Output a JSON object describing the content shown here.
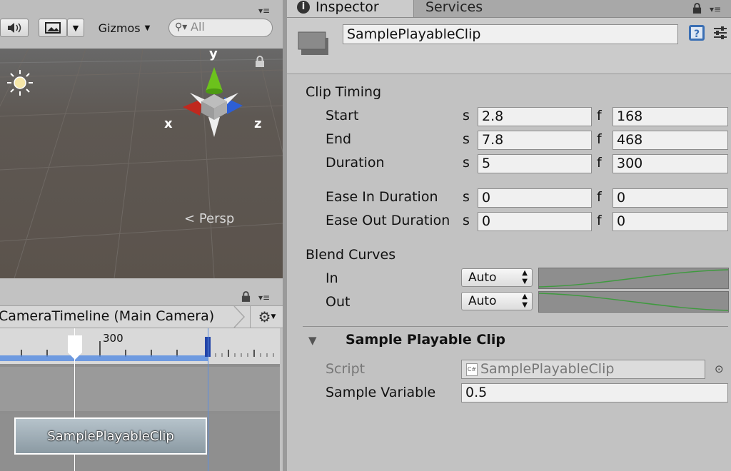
{
  "scene": {
    "gizmos_label": "Gizmos",
    "search_placeholder": "All",
    "persp_label": "Persp",
    "axis_x": "x",
    "axis_y": "y",
    "axis_z": "z"
  },
  "timeline": {
    "title": "CameraTimeline (Main Camera)",
    "ruler_label": "300",
    "clip_name": "SamplePlayableClip"
  },
  "inspector": {
    "tabs": [
      "Inspector",
      "Services"
    ],
    "object_name": "SamplePlayableClip",
    "clip_timing": {
      "section_label": "Clip Timing",
      "rows": [
        {
          "label": "Start",
          "s_unit": "s",
          "s_value": "2.8",
          "f_unit": "f",
          "f_value": "168"
        },
        {
          "label": "End",
          "s_unit": "s",
          "s_value": "7.8",
          "f_unit": "f",
          "f_value": "468"
        },
        {
          "label": "Duration",
          "s_unit": "s",
          "s_value": "5",
          "f_unit": "f",
          "f_value": "300"
        },
        {
          "label": "Ease In Duration",
          "s_unit": "s",
          "s_value": "0",
          "f_unit": "f",
          "f_value": "0"
        },
        {
          "label": "Ease Out Duration",
          "s_unit": "s",
          "s_value": "0",
          "f_unit": "f",
          "f_value": "0"
        }
      ]
    },
    "blend_curves": {
      "section_label": "Blend Curves",
      "in_label": "In",
      "in_mode": "Auto",
      "out_label": "Out",
      "out_mode": "Auto"
    },
    "component": {
      "title": "Sample Playable Clip",
      "script_label": "Script",
      "script_value": "SamplePlayableClip",
      "variable_label": "Sample Variable",
      "variable_value": "0.5"
    }
  },
  "colors": {
    "curve_line": "#3f9a3f",
    "timeline_selection": "#5b8ee0",
    "axis_x": "#c0281e",
    "axis_y": "#6cc21c",
    "axis_z": "#2d5fd6"
  }
}
